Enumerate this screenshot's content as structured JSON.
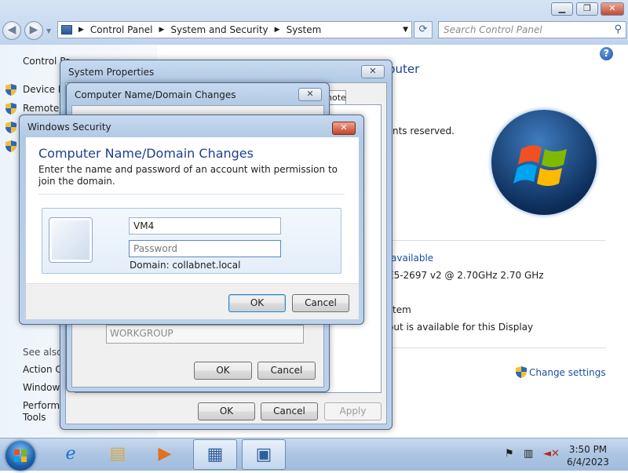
{
  "explorer": {
    "breadcrumb": [
      "Control Panel",
      "System and Security",
      "System"
    ],
    "search_placeholder": "Search Control Panel",
    "left_pane": {
      "top_link": "Control Pa",
      "links": [
        "Device M",
        "Remote s",
        "",
        ""
      ],
      "see_also_title": "See also",
      "see_also": [
        "Action C",
        "Windows",
        "Performa",
        "Tools"
      ]
    },
    "right": {
      "heading_partial": "puter",
      "rights": "nts reserved.",
      "available": "available",
      "processor": "E5-2697 v2 @ 2.70GHz   2.70 GHz",
      "system_type": "tem",
      "display": "out is available for this Display",
      "change_settings": "Change settings"
    }
  },
  "system_properties": {
    "title": "System Properties",
    "tab_partial": "note",
    "ok": "OK",
    "cancel": "Cancel",
    "apply": "Apply"
  },
  "name_changes": {
    "title": "Computer Name/Domain Changes",
    "workgroup": "WORKGROUP",
    "ok": "OK",
    "cancel": "Cancel"
  },
  "windows_security": {
    "title": "Windows Security",
    "heading": "Computer Name/Domain Changes",
    "description": "Enter the name and password of an account with permission to join the domain.",
    "username": "VM4",
    "password_placeholder": "Password",
    "domain_label": "Domain: collabnet.local",
    "ok": "OK",
    "cancel": "Cancel"
  },
  "taskbar": {
    "time": "3:50 PM",
    "date": "6/4/2023"
  },
  "colors": {
    "heading_blue": "#1e3f91",
    "link_blue": "#1a4fa0",
    "close_red": "#c2442a"
  }
}
